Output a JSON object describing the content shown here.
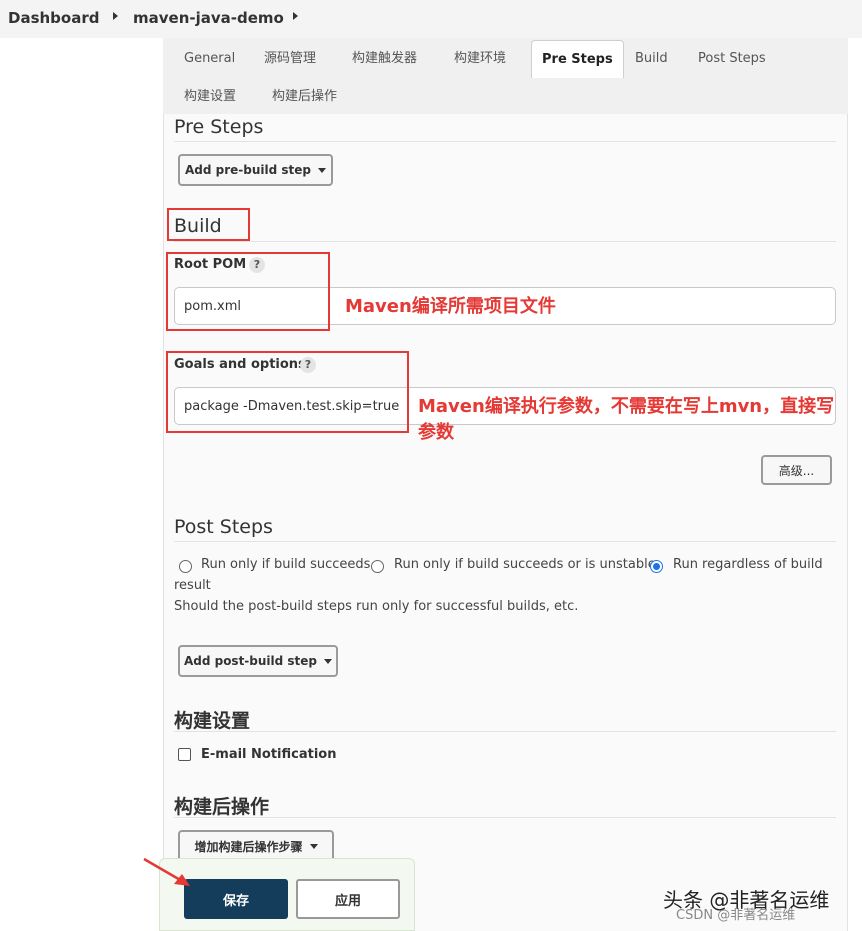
{
  "breadcrumb": {
    "items": [
      "Dashboard",
      "maven-java-demo"
    ]
  },
  "tabs": [
    {
      "label": "General"
    },
    {
      "label": "源码管理"
    },
    {
      "label": "构建触发器"
    },
    {
      "label": "构建环境"
    },
    {
      "label": "Pre Steps",
      "active": true
    },
    {
      "label": "Build"
    },
    {
      "label": "Post Steps"
    },
    {
      "label": "构建设置"
    },
    {
      "label": "构建后操作"
    }
  ],
  "pre_steps": {
    "title": "Pre Steps",
    "add_button": "Add pre-build step"
  },
  "build": {
    "title": "Build",
    "root_pom": {
      "label": "Root POM",
      "help": "?",
      "value": "pom.xml"
    },
    "goals": {
      "label": "Goals and options",
      "help": "?",
      "value": "package -Dmaven.test.skip=true"
    },
    "advanced_button": "高级..."
  },
  "annotations": {
    "root_pom_note": "Maven编译所需项目文件",
    "goals_note": "Maven编译执行参数，不需要在写上mvn，直接写参数"
  },
  "post_steps": {
    "title": "Post Steps",
    "options": [
      {
        "label": "Run only if build succeeds",
        "selected": false
      },
      {
        "label": "Run only if build succeeds or is unstable",
        "selected": false
      },
      {
        "label": "Run regardless of build",
        "selected": true
      }
    ],
    "wrap_text": "result",
    "description": "Should the post-build steps run only for successful builds, etc.",
    "add_button": "Add post-build step"
  },
  "build_settings": {
    "title": "构建设置",
    "email_label": "E-mail Notification",
    "email_checked": false
  },
  "post_build": {
    "title": "构建后操作",
    "add_button": "增加构建后操作步骤"
  },
  "footer": {
    "save": "保存",
    "apply": "应用"
  },
  "watermark": {
    "line1": "头条 @非著名运维",
    "line2": "CSDN @非著名运维"
  },
  "colors": {
    "annotation_red": "#e53935",
    "save_bg": "#143d5c",
    "radio_blue": "#1a73e8"
  }
}
